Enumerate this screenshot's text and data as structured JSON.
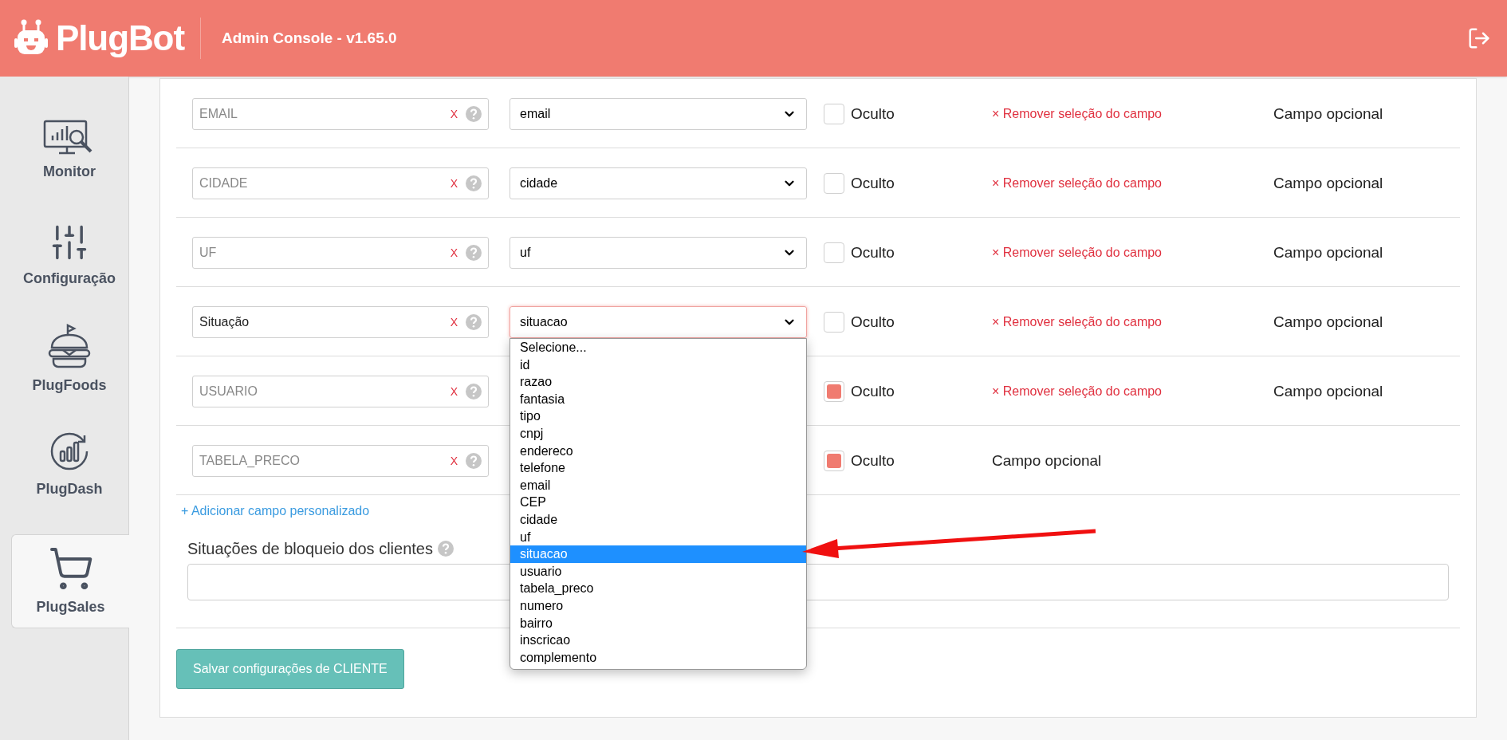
{
  "header": {
    "brand": "PlugBot",
    "title": "Admin Console - v1.65.0"
  },
  "sidebar": {
    "items": [
      {
        "label": "Monitor",
        "kind": "monitor",
        "selected": false
      },
      {
        "label": "Configuração",
        "kind": "sliders",
        "selected": false
      },
      {
        "label": "PlugFoods",
        "kind": "burger",
        "selected": false
      },
      {
        "label": "PlugDash",
        "kind": "dash",
        "selected": false
      },
      {
        "label": "PlugSales",
        "kind": "cart",
        "selected": true
      }
    ]
  },
  "fields": [
    {
      "placeholder": "EMAIL",
      "clear": "X",
      "select_value": "email",
      "hidden_label": "Oculto",
      "hidden": false,
      "remove": "× Remover seleção do campo",
      "note": "Campo opcional"
    },
    {
      "placeholder": "CIDADE",
      "clear": "X",
      "select_value": "cidade",
      "hidden_label": "Oculto",
      "hidden": false,
      "remove": "× Remover seleção do campo",
      "note": "Campo opcional"
    },
    {
      "placeholder": "UF",
      "clear": "X",
      "select_value": "uf",
      "hidden_label": "Oculto",
      "hidden": false,
      "remove": "× Remover seleção do campo",
      "note": "Campo opcional"
    },
    {
      "value": "Situação",
      "clear": "X",
      "select_value": "situacao",
      "focused": true,
      "hidden_label": "Oculto",
      "hidden": false,
      "remove": "× Remover seleção do campo",
      "note": "Campo opcional"
    },
    {
      "placeholder": "USUARIO",
      "clear": "X",
      "hidden_label": "Oculto",
      "hidden": true,
      "remove": "× Remover seleção do campo",
      "note": "Campo opcional"
    },
    {
      "placeholder": "TABELA_PRECO",
      "clear": "X",
      "hidden_label": "Oculto",
      "hidden": true,
      "note": "Campo opcional"
    }
  ],
  "dropdown": {
    "options": [
      {
        "label": "Selecione...",
        "selected": false
      },
      {
        "label": "id",
        "selected": false
      },
      {
        "label": "razao",
        "selected": false
      },
      {
        "label": "fantasia",
        "selected": false
      },
      {
        "label": "tipo",
        "selected": false
      },
      {
        "label": "cnpj",
        "selected": false
      },
      {
        "label": "endereco",
        "selected": false
      },
      {
        "label": "telefone",
        "selected": false
      },
      {
        "label": "email",
        "selected": false
      },
      {
        "label": "CEP",
        "selected": false
      },
      {
        "label": "cidade",
        "selected": false
      },
      {
        "label": "uf",
        "selected": false
      },
      {
        "label": "situacao",
        "selected": true
      },
      {
        "label": "usuario",
        "selected": false
      },
      {
        "label": "tabela_preco",
        "selected": false
      },
      {
        "label": "numero",
        "selected": false
      },
      {
        "label": "bairro",
        "selected": false
      },
      {
        "label": "inscricao",
        "selected": false
      },
      {
        "label": "complemento",
        "selected": false
      }
    ]
  },
  "add_link": "+ Adicionar campo personalizado",
  "block_situations": {
    "label": "Situações de bloqueio dos clientes"
  },
  "save_button": "Salvar configurações de CLIENTE"
}
